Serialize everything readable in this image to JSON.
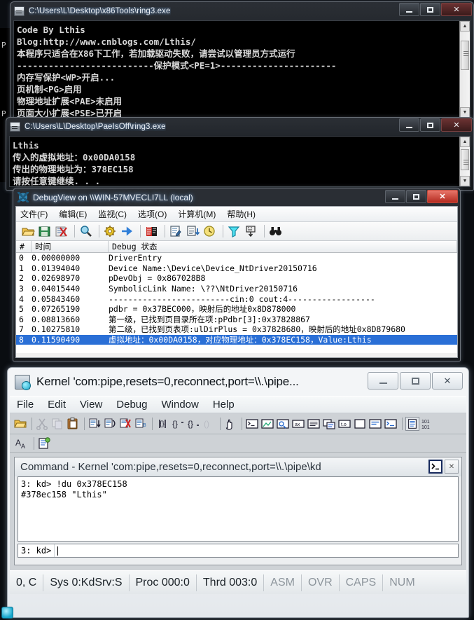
{
  "desktop": {
    "background_fragments": [
      "P",
      "P"
    ]
  },
  "console1": {
    "title": "C:\\Users\\L\\Desktop\\x86Tools\\ring3.exe",
    "icon": "console-icon",
    "buttons": {
      "minimize": "minimize-button",
      "maximize": "maximize-button",
      "close": "close-button"
    },
    "lines": [
      "Code By Lthis",
      "Blog:http://www.cnblogs.com/Lthis/",
      "本程序只适合在X86下工作，若加载驱动失败，请尝试以管理员方式运行",
      "--------------------------保护模式<PE=1>----------------------",
      "内存写保护<WP>开启...",
      "页机制<PG>启用",
      "物理地址扩展<PAE>未启用",
      "页面大小扩展<PSE>已开启"
    ]
  },
  "console2": {
    "title": "C:\\Users\\L\\Desktop\\PaeIsOff\\ring3.exe",
    "icon": "console-icon",
    "lines": [
      "Lthis",
      "传入的虚拟地址：0x00DA0158",
      "传出的物理地址为：378EC158",
      "请按任意键继续. . ."
    ]
  },
  "debugview": {
    "title": "DebugView on \\\\WIN-57MVECLI7LL (local)",
    "icon": "debugview-icon",
    "menu": [
      "文件(F)",
      "编辑(E)",
      "监视(C)",
      "选项(O)",
      "计算机(M)",
      "帮助(H)"
    ],
    "toolbar_icons": [
      "open-icon",
      "save-icon",
      "clear-icon",
      "find-icon",
      "capture-kernel-icon",
      "capture-events-icon",
      "highlight-icon",
      "log-to-file-icon",
      "autoscroll-icon",
      "clock-icon",
      "filter-icon",
      "history-icon",
      "find-binoculars-icon"
    ],
    "columns": [
      "#",
      "时间",
      "Debug 状态"
    ],
    "rows": [
      {
        "n": "0",
        "time": "0.00000000",
        "msg": "DriverEntry"
      },
      {
        "n": "1",
        "time": "0.01394040",
        "msg": "Device Name:\\Device\\Device_NtDriver20150716"
      },
      {
        "n": "2",
        "time": "0.02698970",
        "msg": "pDevObj = 0x867028B8"
      },
      {
        "n": "3",
        "time": "0.04015440",
        "msg": "SymbolicLink Name: \\??\\NtDriver20150716"
      },
      {
        "n": "4",
        "time": "0.05843460",
        "msg": "-------------------------cin:0 cout:4------------------"
      },
      {
        "n": "5",
        "time": "0.07265190",
        "msg": "pdbr = 0x37BEC000，映射后的地址0x8D878000"
      },
      {
        "n": "6",
        "time": "0.08813660",
        "msg": "第一级，已找到页目录所在项:pPdbr[3]:0x37828867"
      },
      {
        "n": "7",
        "time": "0.10275810",
        "msg": "第二级，已找到页表项:ulDirPlus = 0x37828680，映射后的地址0x8D879680"
      },
      {
        "n": "8",
        "time": "0.11590490",
        "msg": "虚拟地址：0x00DA0158，对应物理地址：0x378EC158，Value:Lthis",
        "selected": true
      }
    ],
    "selection_color": "#2a6fd6"
  },
  "windbg": {
    "title": "Kernel 'com:pipe,resets=0,reconnect,port=\\\\.\\pipe...",
    "icon": "windbg-icon",
    "menu": [
      "File",
      "Edit",
      "View",
      "Debug",
      "Window",
      "Help"
    ],
    "toolbar_icons": [
      "open-icon",
      "cut-icon",
      "copy-icon",
      "paste-icon",
      "goto-line-icon",
      "step-into-icon",
      "break-icon",
      "step-icon",
      "restart-icon",
      "step-over-icon",
      "step-out-icon",
      "run-to-cursor-icon",
      "break-hand-icon",
      "command-window-icon",
      "watch-window-icon",
      "locals-window-icon",
      "registers-window-icon",
      "memory-window-icon",
      "call-stack-icon",
      "disassembly-icon",
      "scratch-pad-icon",
      "processes-icon",
      "command-browser-icon",
      "source-window-icon",
      "line-numbers-icon"
    ],
    "toolbar2_icons": [
      "font-icon",
      "log-file-icon"
    ],
    "command_window": {
      "title": "Command - Kernel 'com:pipe,resets=0,reconnect,port=\\\\.\\pipe\\kd",
      "buttons": {
        "restore": "command-prompt-button",
        "close": "close-button"
      },
      "output": "3: kd> !du 0x378EC158\n#378ec158 \"Lthis\"",
      "prompt": "3: kd>",
      "input_value": ""
    },
    "status_bar": [
      {
        "text": "0, C",
        "dim": false
      },
      {
        "text": "Sys 0:KdSrv:S",
        "dim": false
      },
      {
        "text": "Proc 000:0",
        "dim": false
      },
      {
        "text": "Thrd 003:0",
        "dim": false
      },
      {
        "text": "ASM",
        "dim": true
      },
      {
        "text": "OVR",
        "dim": true
      },
      {
        "text": "CAPS",
        "dim": true
      },
      {
        "text": "NUM",
        "dim": true
      }
    ]
  }
}
